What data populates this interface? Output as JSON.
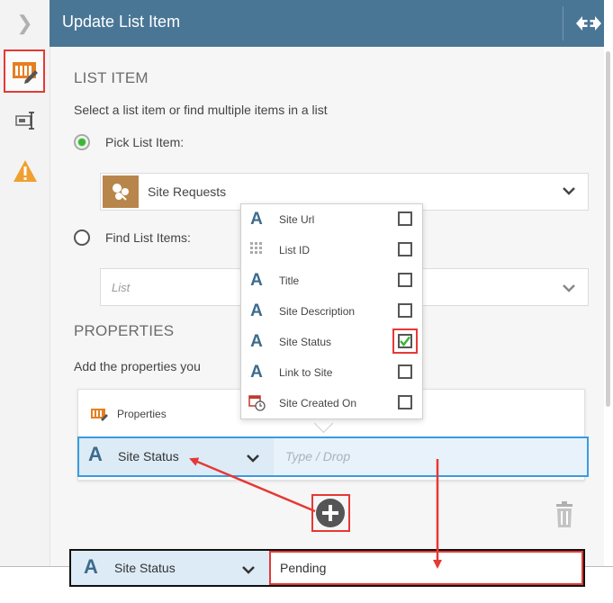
{
  "header": {
    "title": "Update List Item"
  },
  "rail": {
    "items": [
      {
        "icon": "chevron-right-icon"
      },
      {
        "icon": "update-list-item-icon"
      },
      {
        "icon": "input-field-icon"
      },
      {
        "icon": "warning-icon"
      }
    ]
  },
  "list_item": {
    "section_title": "LIST ITEM",
    "description": "Select a list item or find multiple items in a list",
    "pick_label": "Pick List Item:",
    "pick_value": "Site Requests",
    "find_label": "Find List Items:",
    "find_placeholder": "List"
  },
  "properties": {
    "section_title": "PROPERTIES",
    "description": "Add the properties you",
    "card_title": "Properties",
    "row_label": "Site Status",
    "row_placeholder": "Type / Drop"
  },
  "dropdown": {
    "items": [
      {
        "label": "Site Url",
        "icon": "text-type-icon",
        "checked": false
      },
      {
        "label": "List ID",
        "icon": "id-grid-icon",
        "checked": false
      },
      {
        "label": "Title",
        "icon": "text-type-icon",
        "checked": false
      },
      {
        "label": "Site Description",
        "icon": "text-type-icon",
        "checked": false
      },
      {
        "label": "Site Status",
        "icon": "text-type-icon",
        "checked": true
      },
      {
        "label": "Link to Site",
        "icon": "text-type-icon",
        "checked": false
      },
      {
        "label": "Site Created On",
        "icon": "calendar-clock-icon",
        "checked": false
      }
    ]
  },
  "result": {
    "label": "Site Status",
    "value": "Pending"
  },
  "colors": {
    "header": "#4a7696",
    "accent_blue": "#3a9be0",
    "annotation_red": "#e53935",
    "check_green": "#3db53a",
    "list_icon_tan": "#b8864b"
  }
}
